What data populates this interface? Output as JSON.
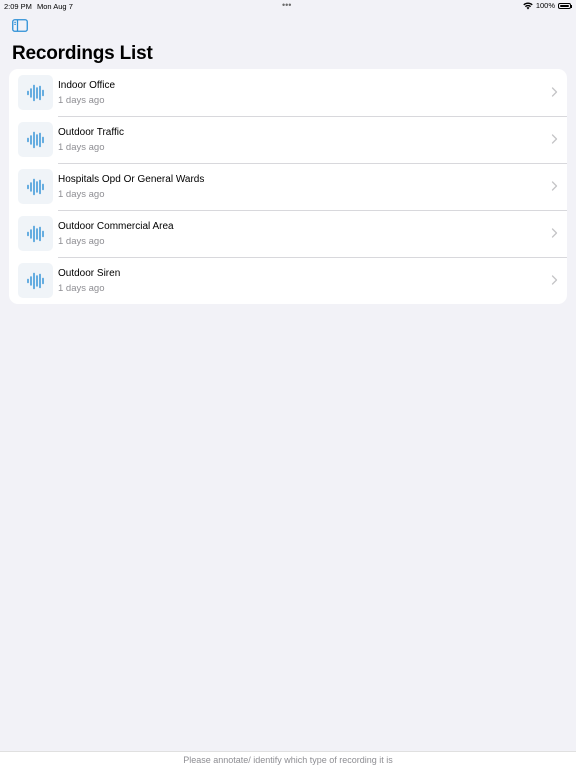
{
  "status_bar": {
    "time": "2:09 PM",
    "date": "Mon Aug 7",
    "battery": "100%",
    "battery_level": 1.0
  },
  "header": {
    "sidebar_icon": "sidebar-left-icon",
    "title": "Recordings List"
  },
  "recordings": [
    {
      "title": "Indoor Office",
      "subtitle": "1 days ago"
    },
    {
      "title": "Outdoor Traffic",
      "subtitle": "1 days ago"
    },
    {
      "title": "Hospitals Opd Or General Wards",
      "subtitle": "1 days ago"
    },
    {
      "title": "Outdoor Commercial Area",
      "subtitle": "1 days ago"
    },
    {
      "title": "Outdoor Siren",
      "subtitle": "1 days ago"
    }
  ],
  "footer": {
    "text": "Please annotate/ identify which type of recording it is"
  },
  "colors": {
    "background": "#f2f2f7",
    "accent": "#2b8fd6",
    "secondary_text": "#8e8e93",
    "chevron": "#c4c4c7"
  }
}
